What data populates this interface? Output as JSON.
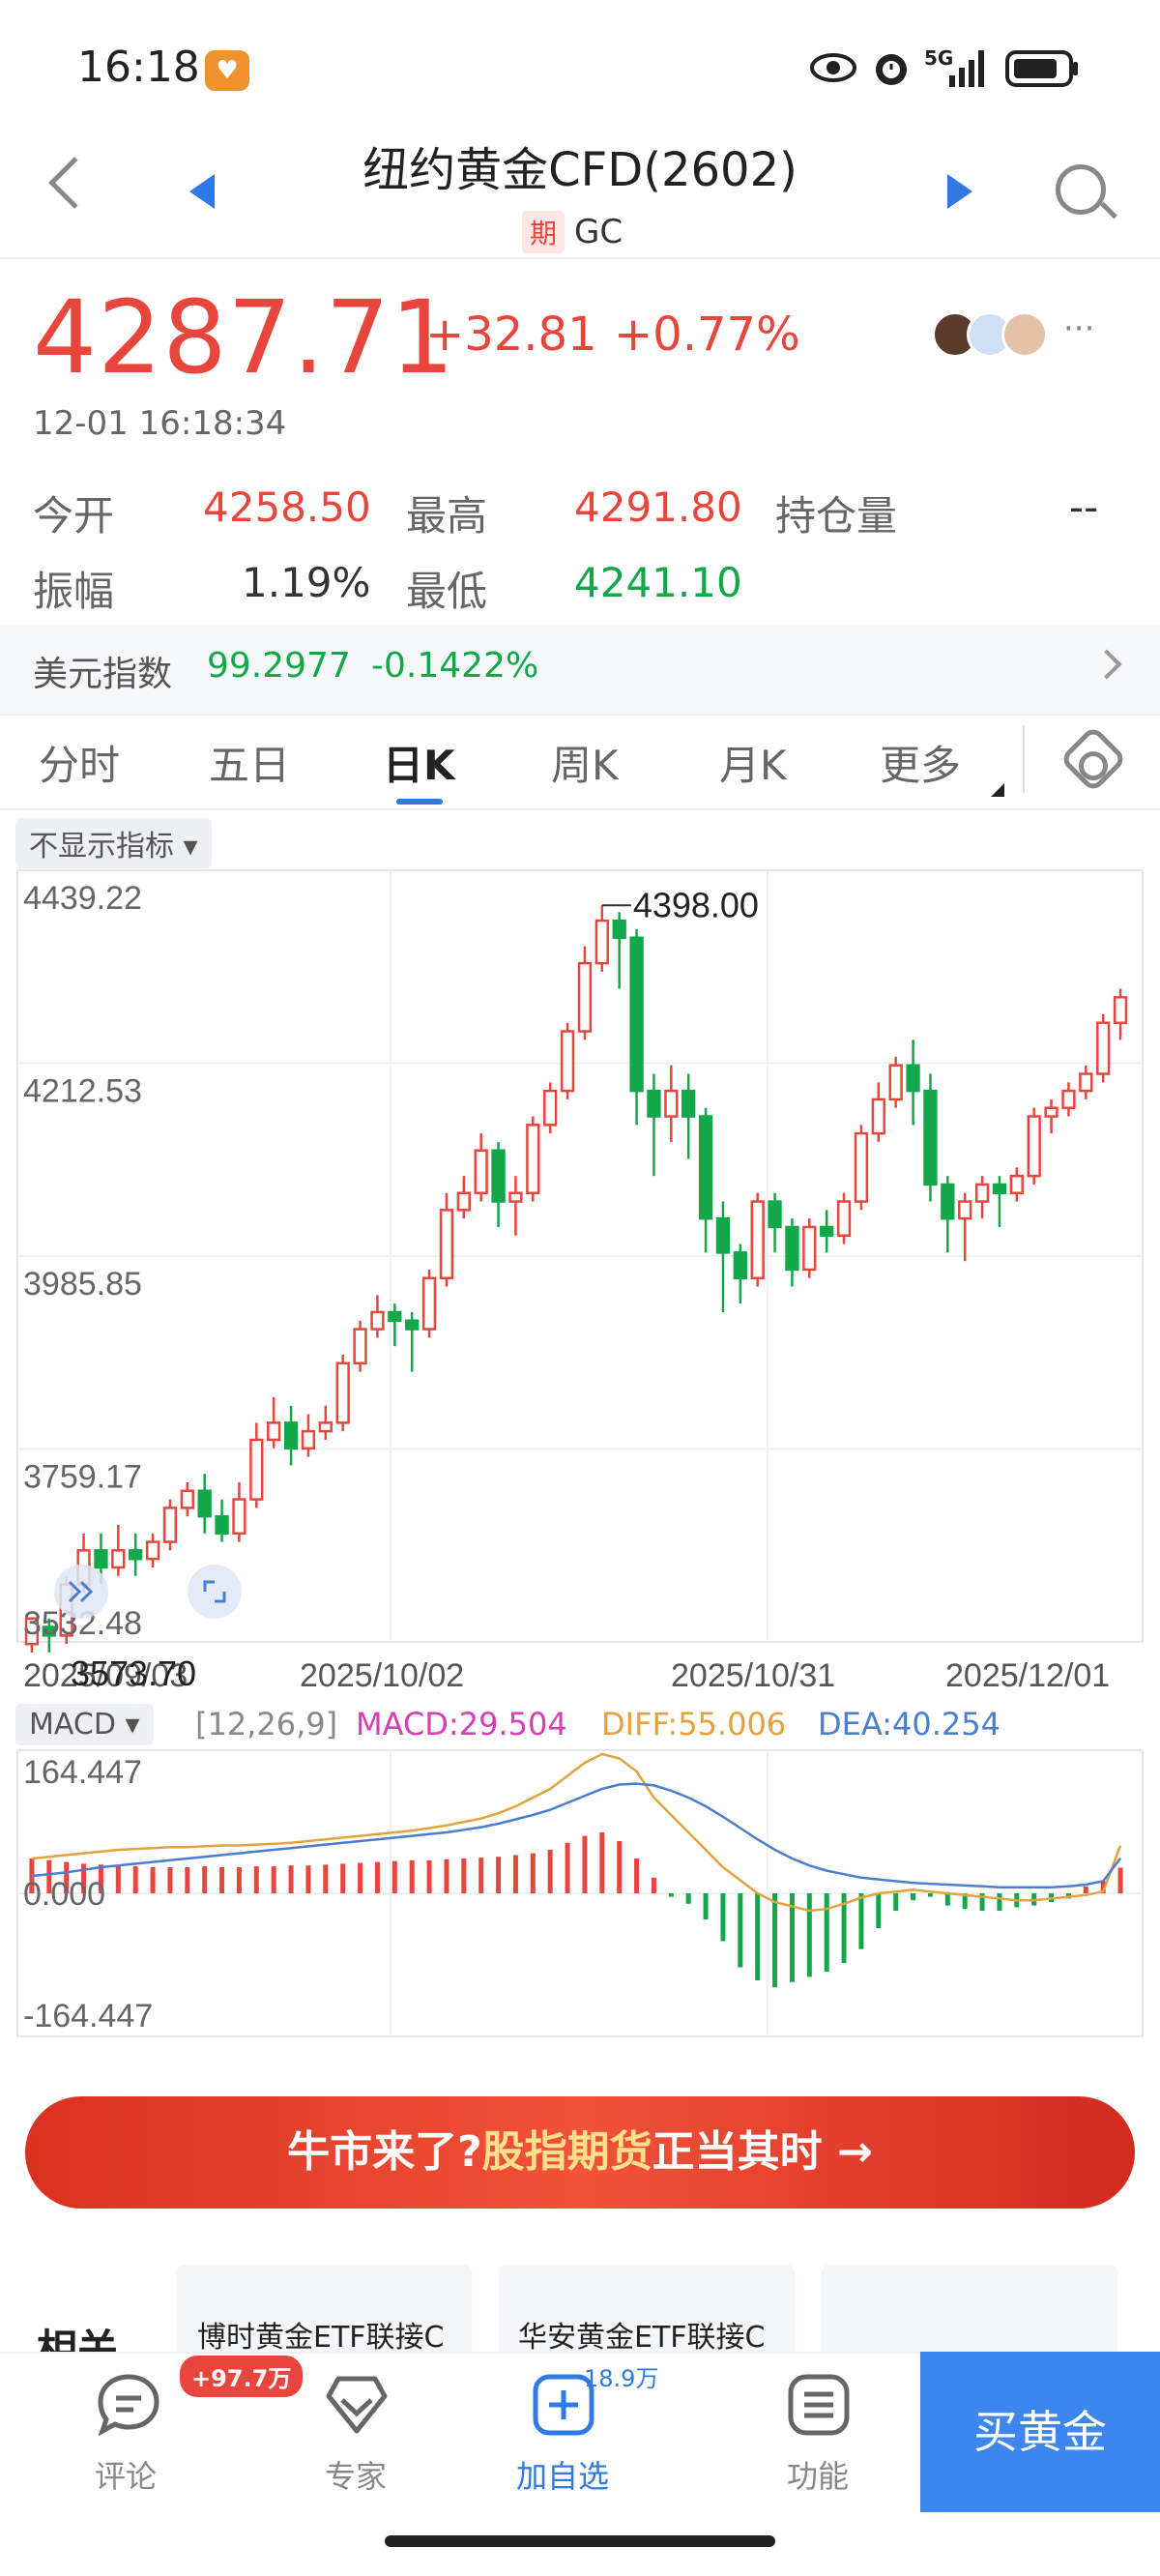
{
  "status_bar": {
    "time": "16:18",
    "network": "5G"
  },
  "header": {
    "title": "纽约黄金CFD(2602)",
    "type_badge": "期",
    "code": "GC"
  },
  "quote": {
    "price": "4287.71",
    "change": "+32.81",
    "change_pct": "+0.77%",
    "datetime": "12-01 16:18:34",
    "more": "···",
    "stats": [
      {
        "label": "今开",
        "value": "4258.50",
        "color": "#e8463c"
      },
      {
        "label": "最高",
        "value": "4291.80",
        "color": "#e8463c"
      },
      {
        "label": "持仓量",
        "value": "--",
        "color": "#333333"
      },
      {
        "label": "振幅",
        "value": "1.19%",
        "color": "#333333"
      },
      {
        "label": "最低",
        "value": "4241.10",
        "color": "#12a84a"
      }
    ]
  },
  "usd_index": {
    "label": "美元指数",
    "value": "99.2977",
    "change": "-0.1422%"
  },
  "tabs": [
    "分时",
    "五日",
    "日K",
    "周K",
    "月K",
    "更多"
  ],
  "indicator_dropdown": "不显示指标",
  "kline": {
    "y_labels": [
      "4439.22",
      "4212.53",
      "3985.85",
      "3759.17",
      "3532.48"
    ],
    "x_labels": [
      "2025/09/03",
      "2025/10/02",
      "2025/10/31",
      "2025/12/01"
    ],
    "max_label": "4398.00",
    "min_label": "3573.70"
  },
  "macd": {
    "dropdown": "MACD",
    "params": "[12,26,9]",
    "macd_text": "MACD:29.504",
    "diff_text": "DIFF:55.006",
    "dea_text": "DEA:40.254",
    "y_labels": [
      "164.447",
      "0.000",
      "-164.447"
    ],
    "colors": {
      "macd": "#d83fb5",
      "diff": "#e6a23c",
      "dea": "#4a7fd0"
    }
  },
  "chart_data": [
    {
      "type": "candlestick",
      "title": "",
      "ylim": [
        3532.48,
        4439.22
      ],
      "x_ticks": [
        "2025/09/03",
        "2025/10/02",
        "2025/10/31",
        "2025/12/01"
      ],
      "series": [
        {
          "name": "",
          "ohlc": [
            [
              3530,
              3560,
              3520,
              3550
            ],
            [
              3550,
              3540,
              3520,
              3560
            ],
            [
              3540,
              3600,
              3530,
              3610
            ],
            [
              3600,
              3640,
              3590,
              3660
            ],
            [
              3640,
              3620,
              3600,
              3660
            ],
            [
              3620,
              3640,
              3610,
              3670
            ],
            [
              3640,
              3630,
              3610,
              3660
            ],
            [
              3630,
              3650,
              3620,
              3660
            ],
            [
              3650,
              3690,
              3640,
              3700
            ],
            [
              3690,
              3710,
              3680,
              3720
            ],
            [
              3710,
              3680,
              3660,
              3730
            ],
            [
              3680,
              3660,
              3650,
              3700
            ],
            [
              3660,
              3700,
              3650,
              3720
            ],
            [
              3700,
              3770,
              3690,
              3790
            ],
            [
              3770,
              3790,
              3760,
              3820
            ],
            [
              3790,
              3760,
              3740,
              3810
            ],
            [
              3760,
              3780,
              3750,
              3800
            ],
            [
              3780,
              3790,
              3770,
              3810
            ],
            [
              3790,
              3860,
              3780,
              3870
            ],
            [
              3860,
              3900,
              3850,
              3910
            ],
            [
              3900,
              3920,
              3890,
              3940
            ],
            [
              3920,
              3910,
              3880,
              3930
            ],
            [
              3910,
              3900,
              3850,
              3920
            ],
            [
              3900,
              3960,
              3890,
              3970
            ],
            [
              3960,
              4040,
              3950,
              4060
            ],
            [
              4040,
              4060,
              4030,
              4080
            ],
            [
              4060,
              4110,
              4050,
              4130
            ],
            [
              4110,
              4050,
              4020,
              4120
            ],
            [
              4050,
              4060,
              4010,
              4080
            ],
            [
              4060,
              4140,
              4050,
              4150
            ],
            [
              4140,
              4180,
              4130,
              4190
            ],
            [
              4180,
              4250,
              4170,
              4260
            ],
            [
              4250,
              4330,
              4240,
              4350
            ],
            [
              4330,
              4380,
              4320,
              4398
            ],
            [
              4380,
              4360,
              4300,
              4390
            ],
            [
              4360,
              4180,
              4140,
              4370
            ],
            [
              4180,
              4150,
              4080,
              4200
            ],
            [
              4150,
              4180,
              4120,
              4210
            ],
            [
              4180,
              4150,
              4100,
              4200
            ],
            [
              4150,
              4030,
              3990,
              4160
            ],
            [
              4030,
              3990,
              3920,
              4050
            ],
            [
              3990,
              3960,
              3930,
              4000
            ],
            [
              3960,
              4050,
              3950,
              4060
            ],
            [
              4050,
              4020,
              3990,
              4060
            ],
            [
              4020,
              3970,
              3950,
              4030
            ],
            [
              3970,
              4020,
              3960,
              4030
            ],
            [
              4020,
              4010,
              3990,
              4040
            ],
            [
              4010,
              4050,
              4000,
              4060
            ],
            [
              4050,
              4130,
              4040,
              4140
            ],
            [
              4130,
              4170,
              4120,
              4190
            ],
            [
              4170,
              4210,
              4160,
              4220
            ],
            [
              4210,
              4180,
              4140,
              4240
            ],
            [
              4180,
              4070,
              4050,
              4200
            ],
            [
              4070,
              4030,
              3990,
              4080
            ],
            [
              4030,
              4050,
              3980,
              4060
            ],
            [
              4050,
              4070,
              4030,
              4080
            ],
            [
              4070,
              4060,
              4020,
              4080
            ],
            [
              4060,
              4080,
              4050,
              4090
            ],
            [
              4080,
              4150,
              4070,
              4160
            ],
            [
              4150,
              4160,
              4130,
              4170
            ],
            [
              4160,
              4180,
              4150,
              4190
            ],
            [
              4180,
              4200,
              4170,
              4210
            ],
            [
              4200,
              4260,
              4190,
              4270
            ],
            [
              4260,
              4290,
              4240,
              4300
            ]
          ]
        }
      ]
    },
    {
      "type": "bar+line",
      "title": "MACD",
      "ylim": [
        -164.447,
        164.447
      ],
      "series": [
        {
          "name": "MACD",
          "values": [
            40,
            38,
            36,
            34,
            33,
            32,
            31,
            30,
            30,
            30,
            31,
            30,
            30,
            31,
            31,
            32,
            32,
            33,
            34,
            35,
            36,
            37,
            38,
            38,
            39,
            40,
            41,
            42,
            44,
            46,
            50,
            58,
            66,
            70,
            60,
            40,
            18,
            -4,
            -12,
            -30,
            -55,
            -85,
            -100,
            -108,
            -102,
            -96,
            -90,
            -80,
            -64,
            -40,
            -20,
            -8,
            -4,
            -14,
            -18,
            -20,
            -20,
            -16,
            -14,
            -10,
            -6,
            8,
            14,
            29.5
          ]
        },
        {
          "name": "DIFF",
          "values": [
            40,
            42,
            44,
            46,
            48,
            50,
            51,
            52,
            53,
            53,
            54,
            55,
            55,
            56,
            57,
            58,
            60,
            62,
            64,
            66,
            68,
            70,
            72,
            75,
            78,
            82,
            86,
            92,
            100,
            110,
            120,
            135,
            150,
            160,
            155,
            140,
            110,
            90,
            70,
            50,
            30,
            15,
            0,
            -10,
            -15,
            -20,
            -18,
            -12,
            -5,
            0,
            2,
            4,
            2,
            0,
            -2,
            -4,
            -6,
            -8,
            -8,
            -6,
            -4,
            -2,
            2,
            55.006
          ]
        },
        {
          "name": "DEA",
          "values": [
            20,
            22,
            24,
            27,
            30,
            32,
            34,
            36,
            38,
            40,
            42,
            44,
            46,
            48,
            50,
            52,
            54,
            56,
            58,
            60,
            62,
            64,
            66,
            68,
            70,
            73,
            76,
            80,
            85,
            90,
            96,
            104,
            112,
            120,
            125,
            126,
            124,
            118,
            110,
            100,
            88,
            75,
            62,
            50,
            40,
            32,
            26,
            22,
            18,
            16,
            14,
            12,
            11,
            10,
            9,
            8,
            7,
            7,
            7,
            7,
            8,
            10,
            14,
            40.254
          ]
        }
      ]
    }
  ],
  "banner": {
    "prefix": "牛市来了?",
    "highlight": "股指期货",
    "suffix": "正当其时 →"
  },
  "related": {
    "label": "相关",
    "cards": [
      "博时黄金ETF联接C",
      "华安黄金ETF联接C",
      ""
    ]
  },
  "bottom_nav": {
    "items": [
      {
        "label": "评论",
        "icon": "comment-icon",
        "badge": "+97.7万"
      },
      {
        "label": "专家",
        "icon": "expert-icon"
      },
      {
        "label": "加自选",
        "icon": "add-watchlist-icon",
        "badge": "18.9万"
      },
      {
        "label": "功能",
        "icon": "menu-icon"
      }
    ],
    "buy_label": "买黄金"
  }
}
